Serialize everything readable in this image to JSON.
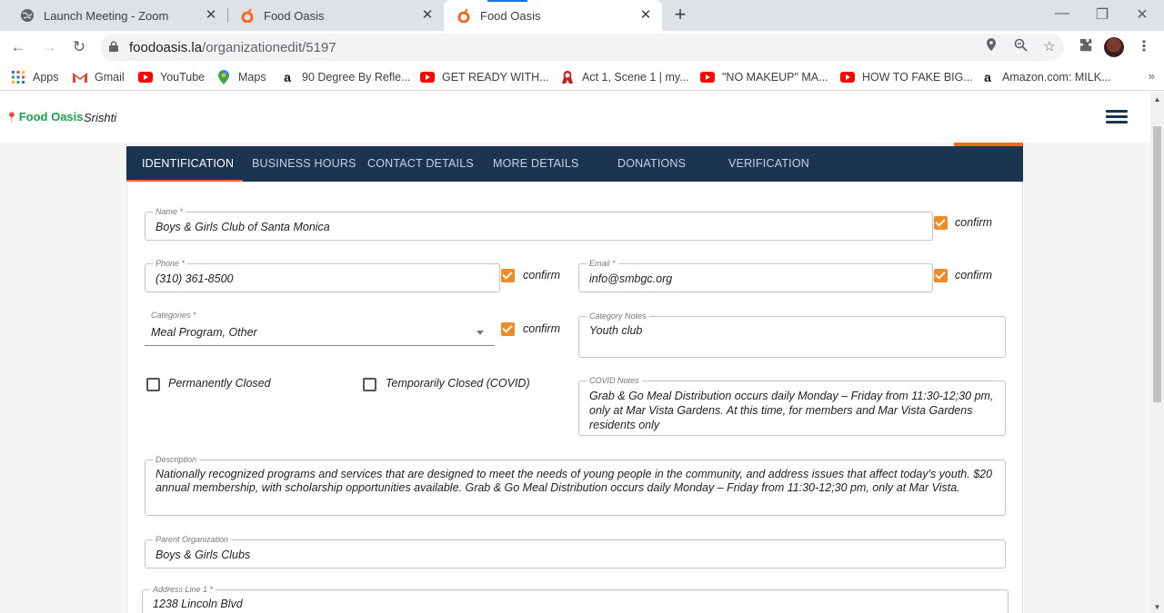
{
  "browser": {
    "tabs": [
      {
        "title": "Launch Meeting - Zoom",
        "icon": "globe-icon"
      },
      {
        "title": "Food Oasis",
        "icon": "food-oasis-favicon"
      },
      {
        "title": "Food Oasis",
        "icon": "food-oasis-favicon",
        "active": true
      }
    ],
    "new_tab_symbol": "+",
    "window_controls": {
      "minimize": "—",
      "restore": "❐",
      "close": "✕"
    },
    "nav": {
      "back": "←",
      "forward": "→",
      "reload": "↻"
    },
    "url_host": "foodoasis.la",
    "url_path": "/organizationedit/5197",
    "toolbar_icons": [
      "location-icon",
      "zoom-icon",
      "star-icon",
      "extensions-icon",
      "profile-avatar",
      "menu-kebab-icon"
    ],
    "bookmarks": [
      {
        "label": "Apps",
        "icon": "apps-grid-icon"
      },
      {
        "label": "Gmail",
        "icon": "gmail-icon"
      },
      {
        "label": "YouTube",
        "icon": "youtube-icon"
      },
      {
        "label": "Maps",
        "icon": "maps-icon"
      },
      {
        "label": "90 Degree By Refle...",
        "icon": "amazon-icon"
      },
      {
        "label": "GET READY WITH...",
        "icon": "youtube-icon"
      },
      {
        "label": "Act 1, Scene 1 | my...",
        "icon": "site-icon"
      },
      {
        "label": "\"NO MAKEUP\" MA...",
        "icon": "youtube-icon"
      },
      {
        "label": "HOW TO FAKE BIG...",
        "icon": "youtube-icon"
      },
      {
        "label": "Amazon.com: MILK...",
        "icon": "amazon-icon"
      }
    ],
    "bookmarks_more": "»"
  },
  "app": {
    "logo_text": "Food Oasis",
    "user_name": "Srishti",
    "tabs": [
      {
        "label": "IDENTIFICATION",
        "active": true
      },
      {
        "label": "BUSINESS HOURS"
      },
      {
        "label": "CONTACT DETAILS"
      },
      {
        "label": "MORE DETAILS"
      },
      {
        "label": "DONATIONS"
      },
      {
        "label": "VERIFICATION"
      }
    ],
    "accent_color": "#f36b21",
    "tabbar_color": "#1b3550",
    "confirm_label": "confirm",
    "form": {
      "name": {
        "label": "Name *",
        "value": "Boys & Girls Club of Santa Monica",
        "confirmed": true
      },
      "phone": {
        "label": "Phone *",
        "value": "(310) 361-8500",
        "confirmed": true
      },
      "email": {
        "label": "Email *",
        "value": "info@smbgc.org",
        "confirmed": true
      },
      "categories": {
        "label": "Categories *",
        "value": "Meal Program, Other",
        "confirmed": true
      },
      "category_notes": {
        "label": "Category Notes",
        "value": "Youth club"
      },
      "permanently_closed": {
        "label": "Permanently Closed",
        "checked": false
      },
      "temporarily_closed": {
        "label": "Temporarily Closed (COVID)",
        "checked": false
      },
      "covid_notes": {
        "label": "COVID Notes",
        "value": "Grab & Go Meal Distribution occurs daily Monday – Friday from 11:30-12;30 pm, only at Mar Vista Gardens. At this time, for members and Mar Vista Gardens residents only"
      },
      "description": {
        "label": "Description",
        "value": "Nationally recognized programs and services that are designed to meet the needs of young people in the community, and address issues that affect today's youth. $20 annual membership, with scholarship opportunities available. Grab & Go Meal Distribution occurs daily Monday – Friday from 11:30-12;30 pm, only at Mar Vista."
      },
      "parent_org": {
        "label": "Parent Organization",
        "value": "Boys & Girls Clubs"
      },
      "address1": {
        "label": "Address Line 1 *",
        "value": "1238 Lincoln Blvd"
      }
    }
  }
}
